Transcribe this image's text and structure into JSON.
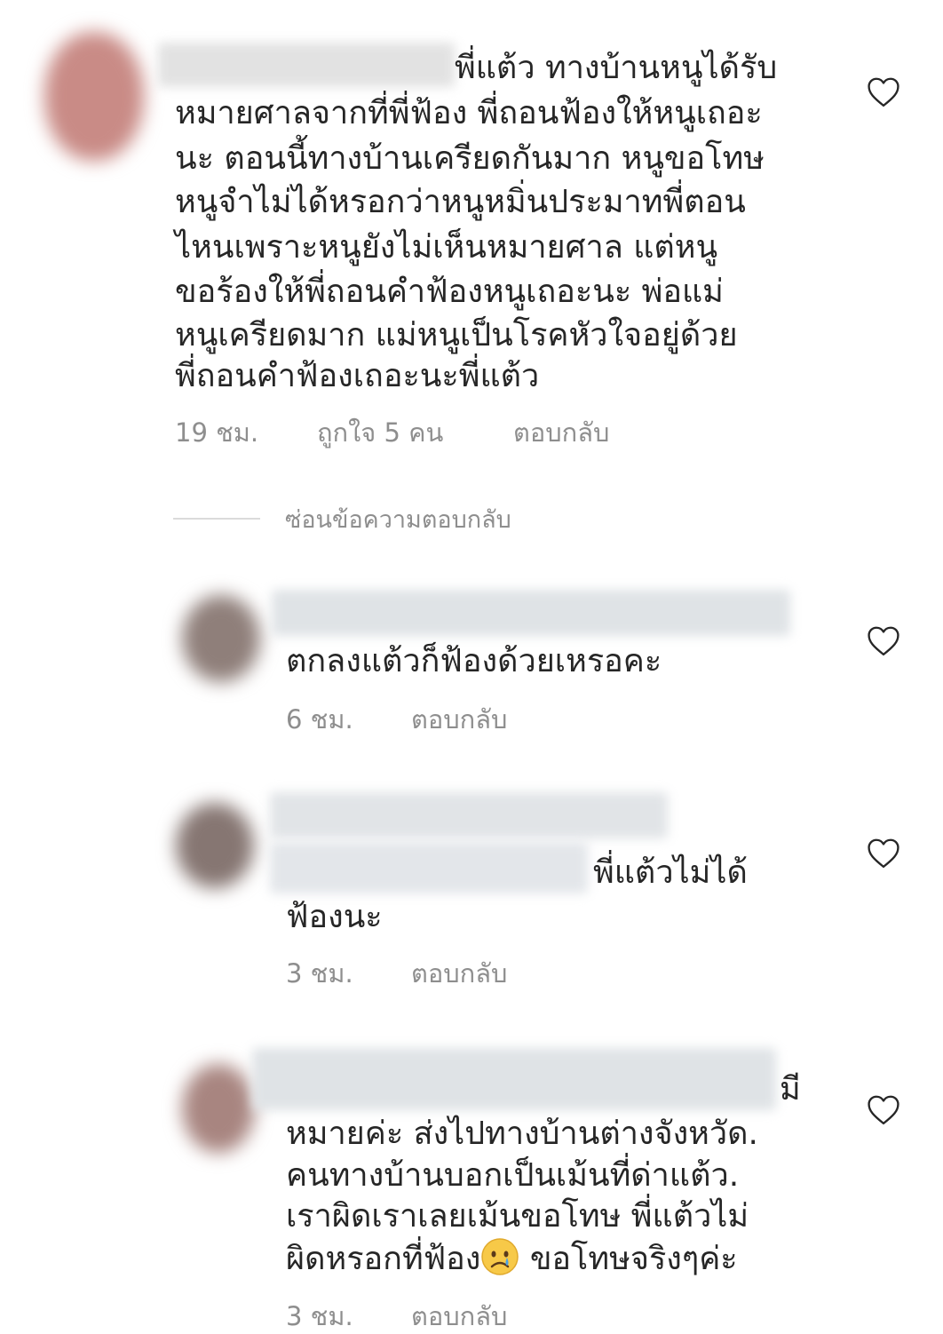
{
  "comments": [
    {
      "lines": [
        "พี่แต้ว ทางบ้านหนูได้รับ",
        "หมายศาลจากที่พี่ฟ้อง พี่ถอนฟ้องให้หนูเถอะ",
        "นะ ตอนนี้ทางบ้านเครียดกันมาก  หนูขอโทษ",
        "หนูจำไม่ได้หรอกว่าหนูหมิ่นประมาทพี่ตอน",
        "ไหนเพราะหนูยังไม่เห็นหมายศาล แต่หนู",
        "ขอร้องให้พี่ถอนคำฟ้องหนูเถอะนะ พ่อแม่",
        "หนูเครียดมาก แม่หนูเป็นโรคหัวใจอยู่ด้วย",
        "พี่ถอนคำฟ้องเถอะนะพี่แต้ว"
      ],
      "time": "19 ชม.",
      "likes": "ถูกใจ 5 คน",
      "reply": "ตอบกลับ"
    },
    {
      "lines": [
        "ตกลงแต้วก็ฟ้องด้วยเหรอคะ"
      ],
      "time": "6 ชม.",
      "reply": "ตอบกลับ"
    },
    {
      "lines": [
        "พี่แต้วไม่ได้",
        "ฟ้องนะ"
      ],
      "time": "3 ชม.",
      "reply": "ตอบกลับ"
    },
    {
      "lines": [
        "มี",
        "หมายค่ะ  ส่งไปทางบ้านต่างจังหวัด.",
        "คนทางบ้านบอกเป็นเม้นที่ด่าแต้ว.",
        "เราผิดเราเลยเม้นขอโทษ พี่แต้วไม่",
        "ผิดหรอกที่ฟ้อง",
        "  ขอโทษจริงๆค่ะ"
      ],
      "emoji": "crying-face-emoji",
      "time": "3 ชม.",
      "reply": "ตอบกลับ"
    }
  ],
  "hide_replies_label": "ซ่อนข้อความตอบกลับ",
  "icons": {
    "like": "heart-outline-icon"
  },
  "colors": {
    "text": "#262626",
    "secondary": "#8e8e8e",
    "divider": "#dbdbdb"
  }
}
